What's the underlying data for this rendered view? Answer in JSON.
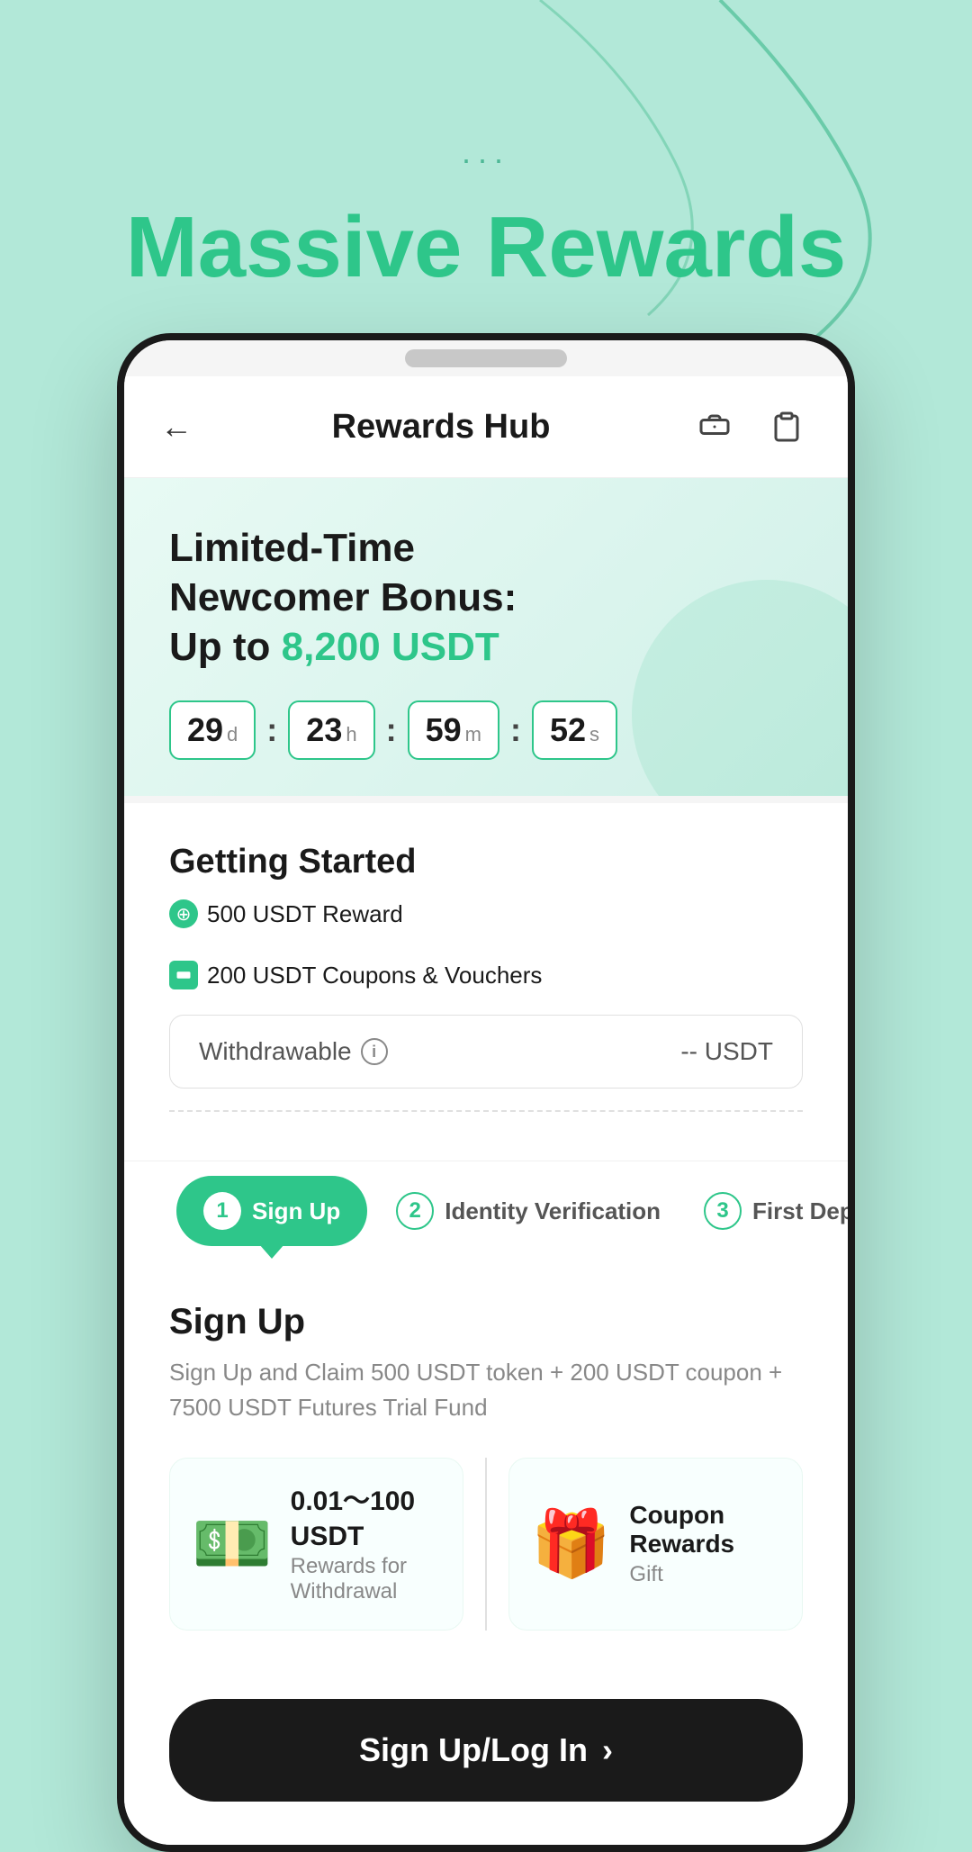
{
  "page": {
    "background_color": "#b2e8d8",
    "dots": "...",
    "headline": {
      "part1": "Massive ",
      "part2": "Rewards"
    }
  },
  "header": {
    "title": "Rewards Hub",
    "back_label": "←",
    "icon1": "ticket-icon",
    "icon2": "clipboard-icon"
  },
  "banner": {
    "line1": "Limited-Time",
    "line2": "Newcomer Bonus:",
    "line3_prefix": "Up to ",
    "line3_amount": "8,200 USDT",
    "countdown": {
      "days": "29",
      "days_unit": "d",
      "hours": "23",
      "hours_unit": "h",
      "minutes": "59",
      "minutes_unit": "m",
      "seconds": "52",
      "seconds_unit": "s"
    }
  },
  "getting_started": {
    "title": "Getting Started",
    "badge1": "500 USDT Reward",
    "badge2": "200 USDT Coupons & Vouchers",
    "withdrawable_label": "Withdrawable",
    "withdrawable_value": "-- USDT"
  },
  "steps": [
    {
      "number": "1",
      "label": "Sign Up",
      "active": true
    },
    {
      "number": "2",
      "label": "Identity Verification",
      "active": false
    },
    {
      "number": "3",
      "label": "First Deposit",
      "active": false
    }
  ],
  "signup_section": {
    "title": "Sign Up",
    "description": "Sign Up and Claim 500 USDT token + 200 USDT coupon + 7500 USDT Futures Trial Fund",
    "reward1": {
      "emoji": "💵",
      "amount": "0.01～100\nUSDT",
      "sub": "Rewards for Withdrawal"
    },
    "reward2": {
      "emoji": "🎁",
      "name": "Coupon\nRewards",
      "sub": "Gift"
    }
  },
  "cta": {
    "label": "Sign Up/Log In",
    "arrow": "›"
  }
}
